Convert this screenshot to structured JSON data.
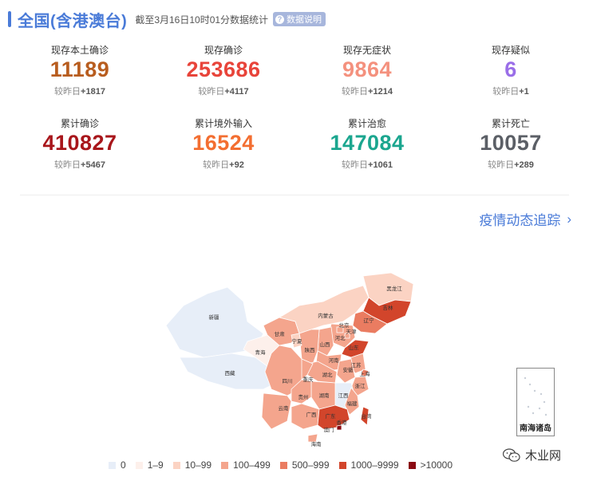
{
  "header": {
    "title": "全国(含港澳台)",
    "subtitle": "截至3月16日10时01分数据统计",
    "explain_label": "数据说明"
  },
  "stats": [
    {
      "label": "现存本土确诊",
      "value": "11189",
      "delta_prefix": "较昨日",
      "delta": "+1817",
      "color": "#b85d1f"
    },
    {
      "label": "现存确诊",
      "value": "253686",
      "delta_prefix": "较昨日",
      "delta": "+4117",
      "color": "#e8443a"
    },
    {
      "label": "现存无症状",
      "value": "9864",
      "delta_prefix": "较昨日",
      "delta": "+1214",
      "color": "#f4917e"
    },
    {
      "label": "现存疑似",
      "value": "6",
      "delta_prefix": "较昨日",
      "delta": "+1",
      "color": "#9a6ee8"
    },
    {
      "label": "累计确诊",
      "value": "410827",
      "delta_prefix": "较昨日",
      "delta": "+5467",
      "color": "#a8161b"
    },
    {
      "label": "累计境外输入",
      "value": "16524",
      "delta_prefix": "较昨日",
      "delta": "+92",
      "color": "#f36e31"
    },
    {
      "label": "累计治愈",
      "value": "147084",
      "delta_prefix": "较昨日",
      "delta": "+1061",
      "color": "#1ba68f"
    },
    {
      "label": "累计死亡",
      "value": "10057",
      "delta_prefix": "较昨日",
      "delta": "+289",
      "color": "#5b5f66"
    }
  ],
  "trend_link": "疫情动态追踪",
  "map": {
    "provinces": [
      "新疆",
      "西藏",
      "青海",
      "甘肃",
      "宁夏",
      "内蒙古",
      "黑龙江",
      "吉林",
      "辽宁",
      "北京",
      "天津",
      "河北",
      "山西",
      "陕西",
      "四川",
      "重庆",
      "云南",
      "贵州",
      "广西",
      "广东",
      "湖南",
      "湖北",
      "河南",
      "山东",
      "江苏",
      "安徽",
      "上海",
      "浙江",
      "江西",
      "福建",
      "台湾",
      "海南",
      "香港",
      "澳门"
    ],
    "inset_label": "南海诸岛"
  },
  "legend": [
    {
      "label": "0",
      "color": "#e7eef8"
    },
    {
      "label": "1–9",
      "color": "#fdf0eb"
    },
    {
      "label": "10–99",
      "color": "#fbd3c3"
    },
    {
      "label": "100–499",
      "color": "#f4a58d"
    },
    {
      "label": "500–999",
      "color": "#ea7c61"
    },
    {
      "label": "1000–9999",
      "color": "#d2452b"
    },
    {
      "label": ">10000",
      "color": "#8a0a12"
    }
  ],
  "watermark": "木业网"
}
